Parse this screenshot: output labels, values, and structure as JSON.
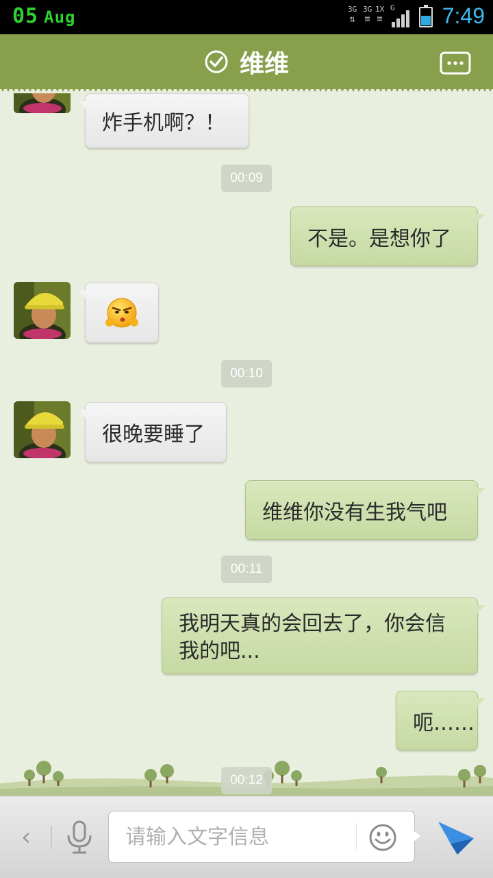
{
  "status_bar": {
    "date_day": "05",
    "date_month": "Aug",
    "net1": "3G",
    "net2": "3G",
    "net3": "1X",
    "net4": "G",
    "time": "7:49",
    "battery_level": 0.55
  },
  "header": {
    "title": "维维",
    "menu_icon": "more-dots-icon",
    "status_icon": "check-circle-icon"
  },
  "messages": [
    {
      "type": "in",
      "text": "炸手机啊？！"
    },
    {
      "type": "time",
      "text": "00:09"
    },
    {
      "type": "out",
      "text": "不是。是想你了"
    },
    {
      "type": "in_emoji",
      "emoji": "smirk-emoji-icon"
    },
    {
      "type": "time",
      "text": "00:10"
    },
    {
      "type": "in",
      "text": "很晚要睡了"
    },
    {
      "type": "out",
      "text": "维维你没有生我气吧"
    },
    {
      "type": "time",
      "text": "00:11"
    },
    {
      "type": "out",
      "text": "我明天真的会回去了，你会信我的吧..."
    },
    {
      "type": "out",
      "text": "呃……"
    },
    {
      "type": "time",
      "text": "00:12"
    }
  ],
  "input_bar": {
    "placeholder": "请输入文字信息",
    "back_icon": "chevron-left-icon",
    "voice_icon": "microphone-icon",
    "emoji_icon": "smiley-icon",
    "send_icon": "paper-plane-icon"
  },
  "colors": {
    "header_green": "#88a04c",
    "outgoing_bubble": "#cadba8",
    "incoming_bubble": "#efefef",
    "chat_background": "#e9efdf",
    "status_date": "#2fd12f",
    "status_time": "#3db9ef",
    "send_blue": "#2e7fd0"
  }
}
